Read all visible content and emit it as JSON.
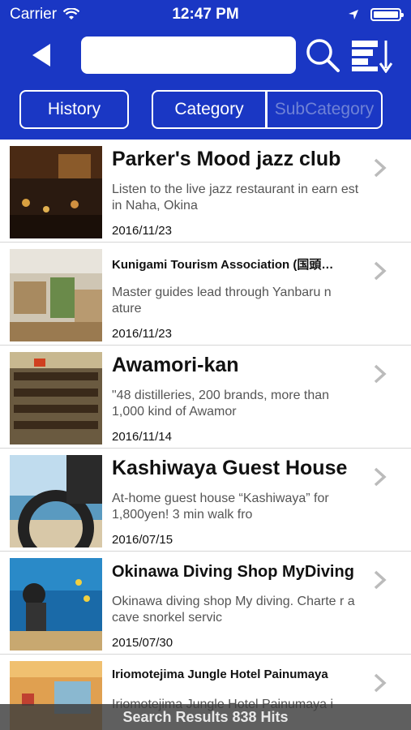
{
  "status_bar": {
    "carrier": "Carrier",
    "time": "12:47 PM"
  },
  "nav": {
    "search_placeholder": "",
    "back_icon": "back-arrow-icon",
    "search_icon": "search-icon",
    "sort_icon": "sort-icon"
  },
  "filters": {
    "history": "History",
    "category": "Category",
    "subcategory": "SubCategory"
  },
  "items": [
    {
      "title": "Parker's Mood jazz club",
      "desc": "Listen to the live jazz restaurant in earn est in Naha, Okina",
      "date": "2016/11/23"
    },
    {
      "title": "Kunigami Tourism Association (国頭…",
      "desc": "Master guides lead through Yanbaru n ature",
      "date": "2016/11/23"
    },
    {
      "title": "Awamori-kan",
      "desc": "\"48 distilleries, 200 brands, more than 1,000 kind of Awamor",
      "date": "2016/11/14"
    },
    {
      "title": "Kashiwaya Guest House",
      "desc": "At-home guest house “Kashiwaya” for 1,800yen! 3 min walk fro",
      "date": "2016/07/15"
    },
    {
      "title": "Okinawa Diving Shop MyDiving",
      "desc": "Okinawa diving shop My diving. Charte r a cave snorkel servic",
      "date": "2015/07/30"
    },
    {
      "title": "Iriomotejima Jungle Hotel Painumaya",
      "desc": "Iriomotejima Jungle Hotel Painumaya i",
      "date": ""
    }
  ],
  "footer": {
    "results": "Search Results 838 Hits"
  },
  "colors": {
    "brand_blue": "#1a37c4",
    "subcategory_disabled": "#6f82d6"
  }
}
